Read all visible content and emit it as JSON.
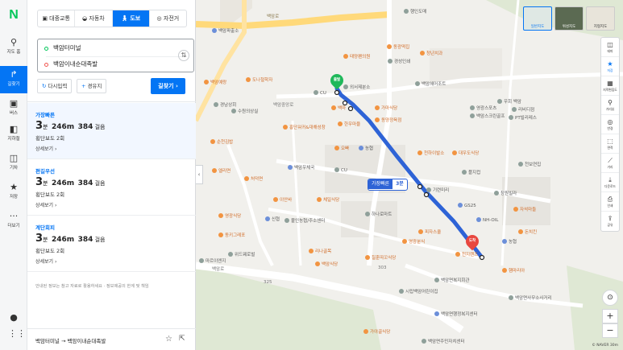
{
  "nav": {
    "logo": "N",
    "items": [
      {
        "label": "지도 홈",
        "icon": "location-pin-icon"
      },
      {
        "label": "길찾기",
        "icon": "directions-icon"
      },
      {
        "label": "버스",
        "icon": "bus-icon"
      },
      {
        "label": "지하철",
        "icon": "subway-icon"
      },
      {
        "label": "기차",
        "icon": "train-icon"
      },
      {
        "label": "저장",
        "icon": "star-icon"
      },
      {
        "label": "더보기",
        "icon": "more-icon"
      }
    ],
    "active_index": 1
  },
  "modes": [
    "대중교통",
    "자동차",
    "도보",
    "자전거"
  ],
  "active_mode": 2,
  "origin": "백암터미널",
  "destination": "백암이내순대족발",
  "buttons": {
    "reset": "다시입력",
    "waypoint": "경유지",
    "go": "길찾기"
  },
  "routes": [
    {
      "tag": "가장빠른",
      "min": "3",
      "min_unit": "분",
      "distance": "246m",
      "steps": "384",
      "steps_unit": "걸음",
      "crossings": "횡단보도 2회",
      "detail": "상세보기"
    },
    {
      "tag": "편길우선",
      "min": "3",
      "min_unit": "분",
      "distance": "246m",
      "steps": "384",
      "steps_unit": "걸음",
      "crossings": "횡단보도 2회",
      "detail": "상세보기"
    },
    {
      "tag": "계단회피",
      "min": "3",
      "min_unit": "분",
      "distance": "246m",
      "steps": "384",
      "steps_unit": "걸음",
      "crossings": "횡단보도 2회",
      "detail": "상세보기"
    }
  ],
  "notice": "안내된 정보는 참고 자료로 활용하세요 · 정보제공의 한계 및 책임",
  "bottom": {
    "summary": "백암터미널 → 백암이내순대족발"
  },
  "map": {
    "route_label": {
      "tag": "가장빠른",
      "time": "3분"
    },
    "start_marker": "출발",
    "end_marker": "도착",
    "thumbs": [
      "일반지도",
      "위성지도",
      "지형지도"
    ],
    "tools": [
      "테마",
      "저장",
      "지적편집도",
      "거리뷰",
      "반경",
      "면적",
      "거리",
      "다운로드",
      "인쇄",
      "공유"
    ],
    "copyright": "© NAVER  30m",
    "pois": [
      {
        "t": "백암파출소",
        "k": "b"
      },
      {
        "t": "경남상회",
        "k": "g"
      },
      {
        "t": "도나철학자",
        "k": "o"
      },
      {
        "t": "수원의상실",
        "k": "g"
      },
      {
        "t": "백암예랑",
        "k": "o"
      },
      {
        "t": "태양펜의원",
        "k": "o"
      },
      {
        "t": "외서제분소",
        "k": "g"
      },
      {
        "t": "경성인쇄",
        "k": "g"
      },
      {
        "t": "동광떡집",
        "k": "o"
      },
      {
        "t": "백암헤어조트",
        "k": "g"
      },
      {
        "t": "청년치과",
        "k": "o"
      },
      {
        "t": "영광스포츠",
        "k": "g"
      },
      {
        "t": "가마식당",
        "k": "o"
      },
      {
        "t": "백마",
        "k": "o"
      },
      {
        "t": "한우마을",
        "k": "o"
      },
      {
        "t": "동양정육점",
        "k": "o"
      },
      {
        "t": "우회 백암",
        "k": "g"
      },
      {
        "t": "백암스크린골프",
        "k": "g"
      },
      {
        "t": "리비디점",
        "k": "g"
      },
      {
        "t": "PT빌리레스",
        "k": "g"
      },
      {
        "t": "순천김밥",
        "k": "o"
      },
      {
        "t": "홍단워귀&대해성창",
        "k": "o"
      },
      {
        "t": "대우도식당",
        "k": "o"
      },
      {
        "t": "천보연집",
        "k": "g"
      },
      {
        "t": "오빠",
        "k": "o"
      },
      {
        "t": "농협",
        "k": "b"
      },
      {
        "t": "천하이발소",
        "k": "o"
      },
      {
        "t": "플지컵",
        "k": "g"
      },
      {
        "t": "창원빌라",
        "k": "g"
      },
      {
        "t": "처덕면",
        "k": "o"
      },
      {
        "t": "백암우체국",
        "k": "b"
      },
      {
        "t": "이안바",
        "k": "o"
      },
      {
        "t": "체일식당",
        "k": "o"
      },
      {
        "t": "하나로마트",
        "k": "g"
      },
      {
        "t": "NH-OIL",
        "k": "b"
      },
      {
        "t": "GS25",
        "k": "b"
      },
      {
        "t": "자석마들",
        "k": "o"
      },
      {
        "t": "불인농협/주소센터",
        "k": "g"
      },
      {
        "t": "신협",
        "k": "b"
      },
      {
        "t": "동키그레포",
        "k": "o"
      },
      {
        "t": "영광식당",
        "k": "o"
      },
      {
        "t": "피자스쿨",
        "k": "o"
      },
      {
        "t": "위드웨로벌",
        "k": "g"
      },
      {
        "t": "마르이엔지",
        "k": "g"
      },
      {
        "t": "돈치킨",
        "k": "o"
      },
      {
        "t": "농협",
        "k": "b"
      },
      {
        "t": "칠훈따꼬식당",
        "k": "o"
      },
      {
        "t": "영광분식",
        "k": "o"
      },
      {
        "t": "백암식당",
        "k": "o"
      },
      {
        "t": "시립백암어린이집",
        "k": "g"
      },
      {
        "t": "백암면복지회관",
        "k": "g"
      },
      {
        "t": "햄마리아",
        "k": "o"
      },
      {
        "t": "백암면사무소사거리",
        "k": "g"
      },
      {
        "t": "백암면행정복지센터",
        "k": "b"
      },
      {
        "t": "가야골식당",
        "k": "o"
      },
      {
        "t": "백암면주민자치센터",
        "k": "g"
      },
      {
        "t": "천지렌즈",
        "k": "o"
      },
      {
        "t": "리나골목",
        "k": "o"
      },
      {
        "t": "CU",
        "k": "g"
      },
      {
        "t": "CU",
        "k": "g"
      },
      {
        "t": "행인도매",
        "k": "g"
      },
      {
        "t": "엘리면",
        "k": "o"
      },
      {
        "t": "기련미리",
        "k": "g"
      }
    ],
    "road_labels": [
      "백암로",
      "325",
      "백암로",
      "303",
      "백암중앙로"
    ]
  }
}
